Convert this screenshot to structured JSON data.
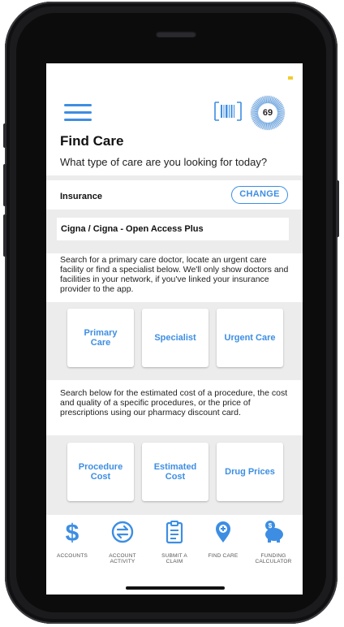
{
  "header": {
    "title": "Find Care",
    "subtitle": "What type of care are you looking for today?",
    "score": "69",
    "menu_icon": "hamburger-menu-icon",
    "barcode_icon": "barcode-icon"
  },
  "insurance": {
    "label": "Insurance",
    "change_label": "CHANGE",
    "plan": "Cigna / Cigna - Open Access Plus"
  },
  "care_section": {
    "description": "Search for a primary care doctor, locate an urgent care facility or find a specialist below. We'll only show doctors and facilities in your network, if you've linked your insurance provider to the app.",
    "cards": [
      {
        "label": "Primary Care"
      },
      {
        "label": "Specialist"
      },
      {
        "label": "Urgent Care"
      }
    ]
  },
  "cost_section": {
    "description": "Search below for the estimated cost of a procedure, the cost and quality of a specific procedures, or the price of prescriptions using our pharmacy discount card.",
    "cards": [
      {
        "label": "Procedure Cost"
      },
      {
        "label": "Estimated Cost"
      },
      {
        "label": "Drug Prices"
      }
    ]
  },
  "bottom_nav": {
    "items": [
      {
        "label": "ACCOUNTS",
        "icon": "dollar-icon"
      },
      {
        "label": "ACCOUNT ACTIVITY",
        "icon": "exchange-icon"
      },
      {
        "label": "SUBMIT A CLAIM",
        "icon": "clipboard-icon"
      },
      {
        "label": "FIND CARE",
        "icon": "location-pin-icon"
      },
      {
        "label": "FUNDING CALCULATOR",
        "icon": "piggy-bank-icon"
      }
    ]
  },
  "colors": {
    "accent": "#3d8ee3",
    "band": "#ececec",
    "status_dot": "#f2cc2b"
  }
}
